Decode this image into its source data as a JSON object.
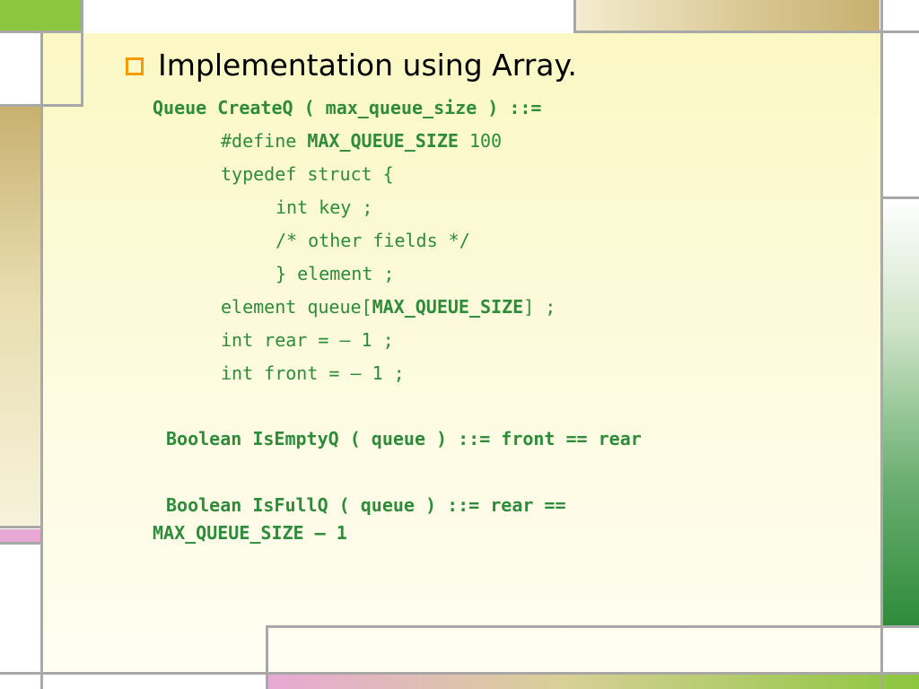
{
  "slide": {
    "title": "Implementation using Array.",
    "bullet_icon": "hollow-square-bullet",
    "colors": {
      "code": "#2e8b3a",
      "bullet": "#f59a00",
      "background_top": "#fbf8c4",
      "green_bar": "#2e8b3a",
      "pink_bar": "#e8a8d4"
    },
    "code": {
      "createq_signature": "Queue CreateQ ( max_queue_size ) ::=",
      "define_prefix": "#define ",
      "define_name": "MAX_QUEUE_SIZE",
      "define_value": " 100",
      "typedef_line": "typedef struct {",
      "int_key_line": "int key ;",
      "comment_line": "/* other fields */",
      "element_close_line": "} element ;",
      "queue_decl_prefix": "element queue[",
      "queue_decl_name": "MAX_QUEUE_SIZE",
      "queue_decl_suffix": "] ;",
      "rear_line": "int rear = – 1 ;",
      "front_line": "int front = – 1 ;",
      "isempty_line": "Boolean IsEmptyQ ( queue ) ::= front == rear",
      "isfull_line1": "Boolean IsFullQ ( queue ) ::= rear ==",
      "isfull_line2_bold": "MAX_QUEUE_SIZE",
      "isfull_line2_rest": " – 1"
    }
  }
}
